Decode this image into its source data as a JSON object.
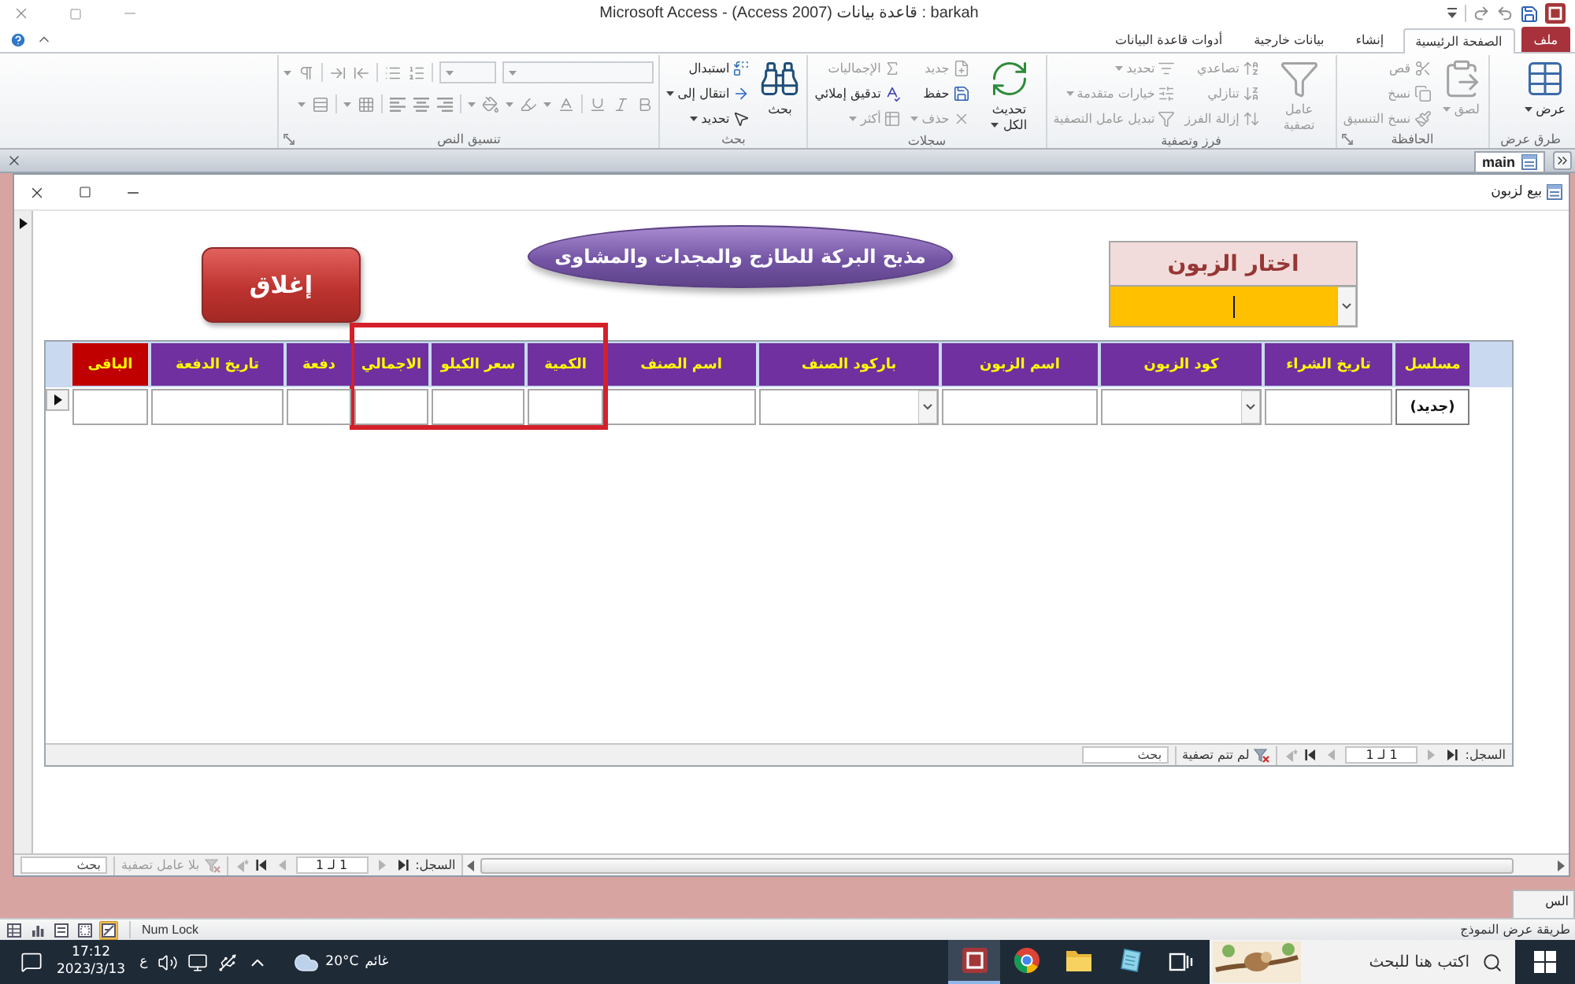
{
  "title_bar": {
    "title": "Microsoft Access - (Access 2007) قاعدة بيانات : barkah"
  },
  "ribbon_tabs": [
    {
      "label": "ملف",
      "kind": "file",
      "selected": false
    },
    {
      "label": "الصفحة الرئيسية",
      "kind": "tab",
      "selected": true
    },
    {
      "label": "إنشاء",
      "kind": "tab",
      "selected": false
    },
    {
      "label": "بيانات خارجية",
      "kind": "tab",
      "selected": false
    },
    {
      "label": "أدوات قاعدة البيانات",
      "kind": "tab",
      "selected": false
    }
  ],
  "ribbon_groups": [
    {
      "label": "طرق عرض",
      "kind": "buttons",
      "launcher": false,
      "items": [
        {
          "label": "عرض",
          "kind": "large",
          "disabled": false,
          "dropdown": true
        }
      ]
    },
    {
      "label": "الحافظة",
      "kind": "buttons",
      "launcher": true,
      "items": [
        {
          "label": "لصق",
          "kind": "large",
          "disabled": true,
          "dropdown": true
        },
        {
          "label": "قص",
          "kind": "small",
          "disabled": true,
          "dropdown": false
        },
        {
          "label": "نسخ",
          "kind": "small",
          "disabled": true,
          "dropdown": false
        },
        {
          "label": "نسخ التنسيق",
          "kind": "small",
          "disabled": true,
          "dropdown": false
        }
      ]
    },
    {
      "label": "فرز وتصفية",
      "kind": "buttons",
      "launcher": false,
      "items": [
        {
          "label": "عامل تصفية",
          "kind": "large",
          "disabled": true,
          "dropdown": false
        },
        {
          "label": "تصاعدي",
          "kind": "small",
          "disabled": true,
          "dropdown": false
        },
        {
          "label": "تنازلي",
          "kind": "small",
          "disabled": true,
          "dropdown": false
        },
        {
          "label": "إزالة الفرز",
          "kind": "small",
          "disabled": true,
          "dropdown": false
        },
        {
          "label": "تحديد",
          "kind": "small",
          "disabled": true,
          "dropdown": true
        },
        {
          "label": "خيارات متقدمة",
          "kind": "small",
          "disabled": true,
          "dropdown": true
        },
        {
          "label": "تبديل عامل التصفية",
          "kind": "small",
          "disabled": true,
          "dropdown": false
        }
      ]
    },
    {
      "label": "سجلات",
      "kind": "buttons",
      "launcher": false,
      "items": [
        {
          "label": "تحديث الكل",
          "kind": "large",
          "disabled": false,
          "dropdown": true
        },
        {
          "label": "جديد",
          "kind": "small",
          "disabled": true,
          "dropdown": false
        },
        {
          "label": "حفظ",
          "kind": "small",
          "disabled": false,
          "dropdown": false
        },
        {
          "label": "حذف",
          "kind": "small",
          "disabled": true,
          "dropdown": true
        },
        {
          "label": "الإجماليات",
          "kind": "small",
          "disabled": true,
          "dropdown": false
        },
        {
          "label": "تدقيق إملائي",
          "kind": "small",
          "disabled": false,
          "dropdown": false
        },
        {
          "label": "أكثر",
          "kind": "small",
          "disabled": true,
          "dropdown": true
        }
      ]
    },
    {
      "label": "بحث",
      "kind": "buttons",
      "launcher": false,
      "items": [
        {
          "label": "بحث",
          "kind": "large",
          "disabled": false,
          "dropdown": false
        },
        {
          "label": "استبدال",
          "kind": "small",
          "disabled": false,
          "dropdown": false
        },
        {
          "label": "انتقال إلى",
          "kind": "small",
          "disabled": false,
          "dropdown": true
        },
        {
          "label": "تحديد",
          "kind": "small",
          "disabled": false,
          "dropdown": true
        }
      ]
    },
    {
      "label": "تنسيق النص",
      "kind": "text_format",
      "launcher": true,
      "disabled": true
    }
  ],
  "document_tabs": [
    {
      "label": "main",
      "selected": true
    }
  ],
  "form": {
    "title": "بيع لزبون",
    "current": true,
    "heading": "مذبح البركة للطازج والمجدات والمشاوى",
    "close_button": "إغلاق",
    "customer_picker": {
      "label": "اختار الزبون",
      "focused": true
    },
    "subform": {
      "columns": [
        {
          "label": "مسلسل",
          "kind": "counter",
          "color": "#7030a0",
          "selected": false
        },
        {
          "label": "تاريخ الشراء",
          "kind": "text",
          "color": "#7030a0",
          "selected": false
        },
        {
          "label": "كود الزبون",
          "kind": "combo",
          "color": "#7030a0",
          "selected": false
        },
        {
          "label": "اسم الزبون",
          "kind": "text",
          "color": "#7030a0",
          "selected": false
        },
        {
          "label": "باركود الصنف",
          "kind": "combo",
          "color": "#7030a0",
          "selected": false
        },
        {
          "label": "اسم الصنف",
          "kind": "text",
          "color": "#7030a0",
          "selected": false
        },
        {
          "label": "الكمية",
          "kind": "text",
          "color": "#7030a0",
          "selected": true
        },
        {
          "label": "سعر الكيلو",
          "kind": "text",
          "color": "#7030a0",
          "selected": true
        },
        {
          "label": "الاجمالي",
          "kind": "text",
          "color": "#7030a0",
          "selected": true
        },
        {
          "label": "دفعة",
          "kind": "text",
          "color": "#7030a0",
          "selected": false
        },
        {
          "label": "تاريخ الدفعة",
          "kind": "text",
          "color": "#7030a0",
          "selected": false
        },
        {
          "label": "الباقى",
          "kind": "text",
          "color": "#c00000",
          "selected": false
        }
      ],
      "new_row": {
        "counter": "(جديد)",
        "current": true
      },
      "navigation": {
        "label": "السجل:",
        "position": "1 لـ 1",
        "filter": "لم تتم تصفية",
        "filter_disabled": false,
        "search_placeholder": "بحث"
      }
    },
    "navigation": {
      "label": "السجل:",
      "position": "1 لـ 1",
      "filter": "بلا عامل تصفية",
      "filter_disabled": true,
      "search_placeholder": "بحث"
    }
  },
  "background_window": {
    "text": "الس"
  },
  "status_bar": {
    "view_buttons": [
      {
        "selected": false
      },
      {
        "selected": false
      },
      {
        "selected": false
      },
      {
        "selected": false
      },
      {
        "selected": true
      }
    ],
    "indicator": "Num Lock",
    "view_name": "طريقة عرض النموذج"
  },
  "taskbar": {
    "time": "17:12",
    "date": "2023/3/13",
    "language": "ع",
    "weather": {
      "temperature": "20°C",
      "condition": "غائم"
    },
    "apps": [
      {
        "active": true
      },
      {
        "active": false
      },
      {
        "active": false
      },
      {
        "active": false
      }
    ],
    "search_placeholder": "اكتب هنا للبحث"
  }
}
